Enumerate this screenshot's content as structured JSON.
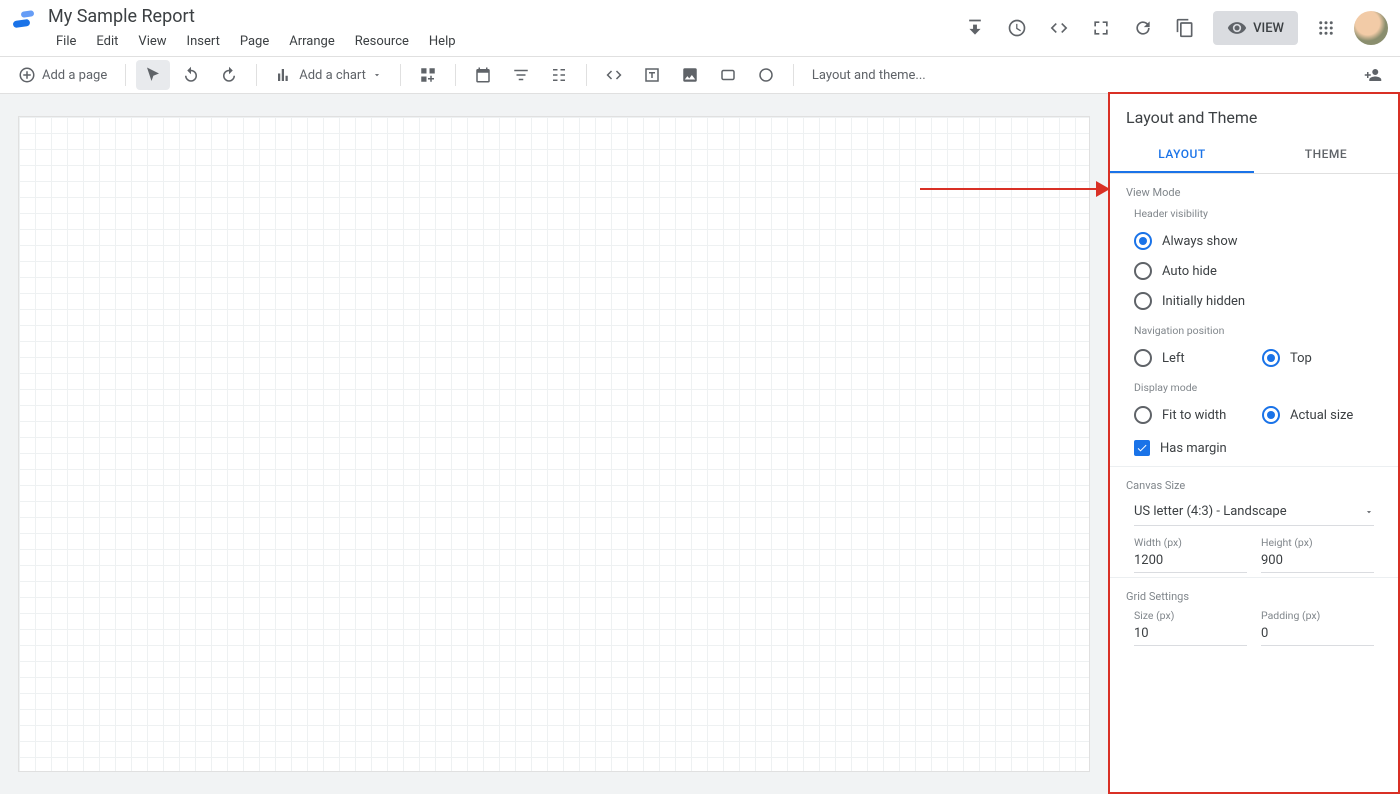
{
  "header": {
    "doc_title": "My Sample Report",
    "menu": [
      "File",
      "Edit",
      "View",
      "Insert",
      "Page",
      "Arrange",
      "Resource",
      "Help"
    ],
    "view_button": "VIEW"
  },
  "toolbar": {
    "add_page": "Add a page",
    "add_chart": "Add a chart",
    "layout_theme": "Layout and theme..."
  },
  "panel": {
    "title": "Layout and Theme",
    "tabs": {
      "layout": "LAYOUT",
      "theme": "THEME"
    },
    "view_mode": {
      "section": "View Mode",
      "header_visibility": {
        "label": "Header visibility",
        "options": {
          "always": "Always show",
          "auto": "Auto hide",
          "initial": "Initially hidden"
        },
        "selected": "always"
      },
      "nav_position": {
        "label": "Navigation position",
        "options": {
          "left": "Left",
          "top": "Top"
        },
        "selected": "top"
      },
      "display_mode": {
        "label": "Display mode",
        "options": {
          "fit": "Fit to width",
          "actual": "Actual size"
        },
        "selected": "actual"
      },
      "has_margin": "Has margin"
    },
    "canvas_size": {
      "section": "Canvas Size",
      "preset": "US letter (4:3) - Landscape",
      "width_label": "Width (px)",
      "width_value": "1200",
      "height_label": "Height (px)",
      "height_value": "900"
    },
    "grid_settings": {
      "section": "Grid Settings",
      "size_label": "Size (px)",
      "size_value": "10",
      "padding_label": "Padding (px)",
      "padding_value": "0"
    }
  }
}
